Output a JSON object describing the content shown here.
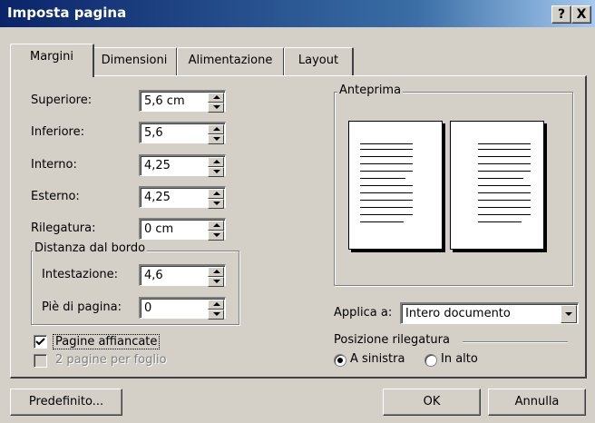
{
  "window": {
    "title": "Imposta pagina",
    "help_btn": "?",
    "close_btn": "X"
  },
  "tabs": [
    {
      "label": "Margini",
      "active": true
    },
    {
      "label": "Dimensioni",
      "active": false
    },
    {
      "label": "Alimentazione",
      "active": false
    },
    {
      "label": "Layout",
      "active": false
    }
  ],
  "margins": {
    "superiore": {
      "label": "Superiore:",
      "value": "5,6 cm"
    },
    "inferiore": {
      "label": "Inferiore:",
      "value": "5,6"
    },
    "interno": {
      "label": "Interno:",
      "value": "4,25"
    },
    "esterno": {
      "label": "Esterno:",
      "value": "4,25"
    },
    "rilegatura": {
      "label": "Rilegatura:",
      "value": "0 cm"
    }
  },
  "distanza": {
    "title": "Distanza dal bordo",
    "intestazione": {
      "label": "Intestazione:",
      "value": "4,6"
    },
    "pie": {
      "label": "Piè di pagina:",
      "value": "0"
    }
  },
  "checks": {
    "pagine_affiancate": {
      "label": "Pagine affiancate",
      "checked": true
    },
    "due_pagine": {
      "label": "2 pagine per foglio",
      "checked": false,
      "disabled": true
    }
  },
  "preview": {
    "title": "Anteprima"
  },
  "applica": {
    "label": "Applica a:",
    "value": "Intero documento"
  },
  "posizione": {
    "title": "Posizione rilegatura",
    "sinistra": {
      "label": "A sinistra",
      "selected": true
    },
    "alto": {
      "label": "In alto",
      "selected": false
    }
  },
  "buttons": {
    "predefinito": "Predefinito...",
    "ok": "OK",
    "annulla": "Annulla"
  }
}
